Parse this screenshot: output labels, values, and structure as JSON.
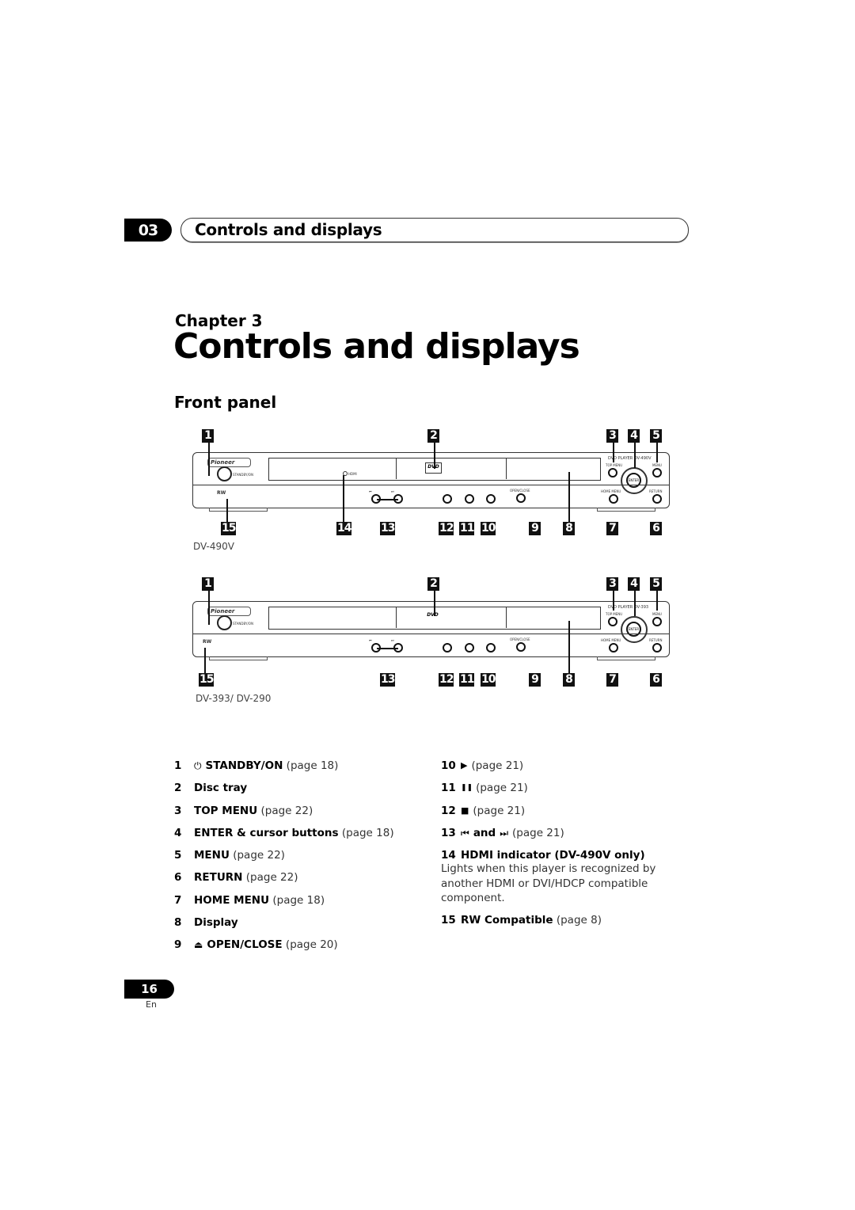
{
  "header": {
    "chapter_number": "03",
    "chapter_title": "Controls and displays"
  },
  "chapter_label": "Chapter 3",
  "page_title": "Controls and displays",
  "section_title": "Front panel",
  "diagrams": [
    {
      "model_caption": "DV-490V",
      "model_badge": "DVD PLAYER  DV-490V",
      "top_callouts": [
        "1",
        "2",
        "3",
        "4",
        "5"
      ],
      "bottom_callouts": [
        "15",
        "14",
        "13",
        "12",
        "11",
        "10",
        "9",
        "8",
        "7",
        "6"
      ],
      "panel_labels": {
        "brand": "Pioneer",
        "standby": "STANDBY/ON",
        "hdmi": "HDMI",
        "dvd_logo": "DVD",
        "top_menu": "TOP MENU",
        "menu": "MENU",
        "enter": "ENTER",
        "home_menu": "HOME MENU",
        "return": "RETURN",
        "open_close": "OPEN/CLOSE",
        "rw": "RW"
      }
    },
    {
      "model_caption": "DV-393/ DV-290",
      "model_badge": "DVD PLAYER  DV-393",
      "top_callouts": [
        "1",
        "2",
        "3",
        "4",
        "5"
      ],
      "bottom_callouts": [
        "15",
        "13",
        "12",
        "11",
        "10",
        "9",
        "8",
        "7",
        "6"
      ],
      "panel_labels": {
        "brand": "Pioneer",
        "standby": "STANDBY/ON",
        "dvd_logo": "DVD",
        "top_menu": "TOP MENU",
        "menu": "MENU",
        "enter": "ENTER",
        "home_menu": "HOME MENU",
        "return": "RETURN",
        "open_close": "OPEN/CLOSE",
        "rw": "RW"
      }
    }
  ],
  "legend_left": [
    {
      "num": "1",
      "icon": "⏻",
      "label": "STANDBY/ON",
      "ref": "(page 18)"
    },
    {
      "num": "2",
      "icon": "",
      "label": "Disc tray",
      "ref": ""
    },
    {
      "num": "3",
      "icon": "",
      "label": "TOP MENU",
      "ref": "(page 22)"
    },
    {
      "num": "4",
      "icon": "",
      "label": "ENTER & cursor buttons",
      "ref": "(page 18)"
    },
    {
      "num": "5",
      "icon": "",
      "label": "MENU",
      "ref": "(page 22)"
    },
    {
      "num": "6",
      "icon": "",
      "label": "RETURN",
      "ref": "(page 22)"
    },
    {
      "num": "7",
      "icon": "",
      "label": "HOME MENU",
      "ref": "(page 18)"
    },
    {
      "num": "8",
      "icon": "",
      "label": "Display",
      "ref": ""
    },
    {
      "num": "9",
      "icon": "⏏",
      "label": "OPEN/CLOSE",
      "ref": "(page 20)"
    }
  ],
  "legend_right": [
    {
      "num": "10",
      "icon": "▶",
      "label": "",
      "ref": "(page 21)"
    },
    {
      "num": "11",
      "icon": "❚❚",
      "label": "",
      "ref": "(page 21)"
    },
    {
      "num": "12",
      "icon": "■",
      "label": "",
      "ref": "(page 21)"
    },
    {
      "num": "13",
      "icon": "⏮",
      "label": "and",
      "icon2": "⏭",
      "ref": "(page 21)"
    },
    {
      "num": "14",
      "icon": "",
      "label": "HDMI indicator (DV-490V only)",
      "ref": "",
      "desc": "Lights when this player is recognized by another HDMI or DVI/HDCP compatible component."
    },
    {
      "num": "15",
      "icon": "",
      "label": "RW Compatible",
      "ref": "(page 8)"
    }
  ],
  "footer": {
    "page_number": "16",
    "language": "En"
  }
}
